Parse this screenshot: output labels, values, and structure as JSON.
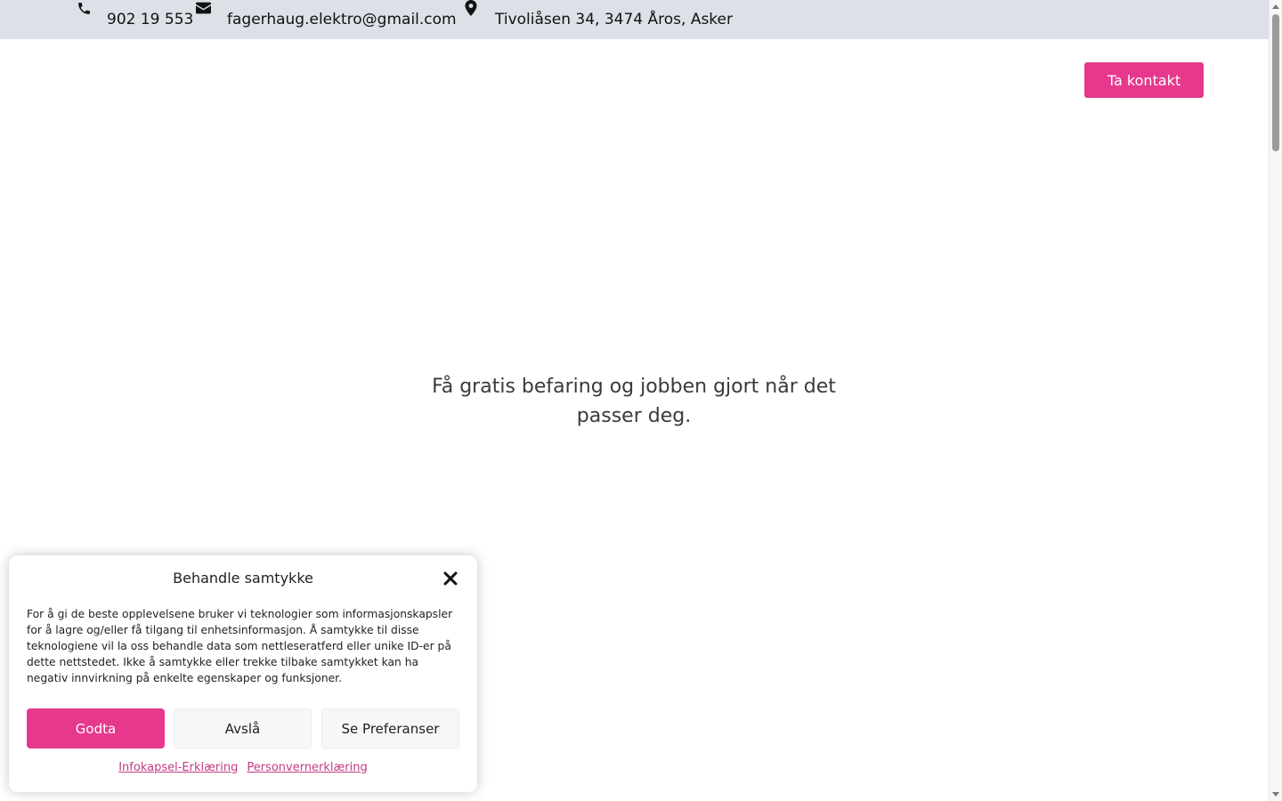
{
  "topbar": {
    "phone": "902 19 553",
    "email": "fagerhaug.elektro@gmail.com",
    "address": "Tivoliåsen 34, 3474 Åros, Asker",
    "icons": {
      "phone": "phone-icon",
      "email": "envelope-icon",
      "address": "map-pin-icon"
    }
  },
  "header": {
    "cta_label": "Ta kontakt"
  },
  "hero": {
    "text": "Få gratis befaring og jobben gjort når det passer deg."
  },
  "consent": {
    "title": "Behandle samtykke",
    "body": "For å gi de beste opplevelsene bruker vi teknologier som informasjonskapsler for å lagre og/eller få tilgang til enhetsinformasjon. Å samtykke til disse teknologiene vil la oss behandle data som nettleseratferd eller unike ID-er på dette nettstedet. Ikke å samtykke eller trekke tilbake samtykket kan ha negativ innvirkning på enkelte egenskaper og funksjoner.",
    "accept_label": "Godta",
    "deny_label": "Avslå",
    "preferences_label": "Se Preferanser",
    "cookie_policy_link": "Infokapsel-Erklæring",
    "privacy_policy_link": "Personvernerklæring"
  },
  "colors": {
    "accent": "#e6388c",
    "topbar_bg": "#dce1e8",
    "link": "#c23a85"
  }
}
